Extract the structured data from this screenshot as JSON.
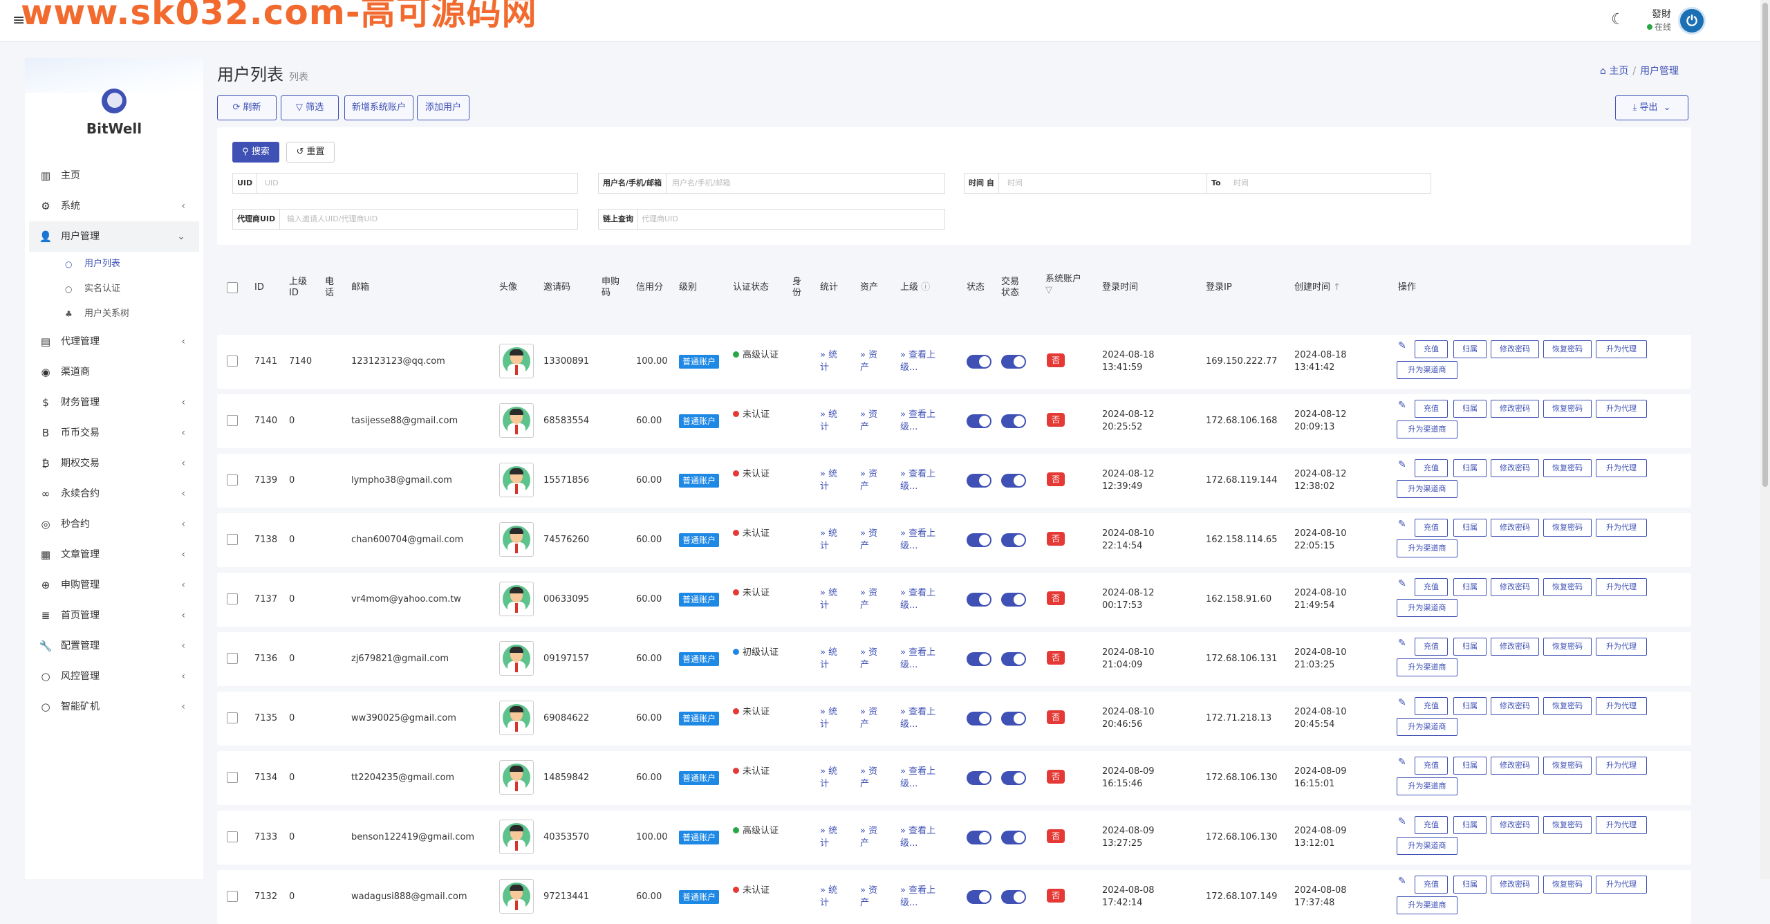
{
  "watermark": "www.sk032.com-高可源码网",
  "topbar": {
    "user_name": "發財",
    "user_status": "在线"
  },
  "sidebar": {
    "brand": "BitWell",
    "items": [
      {
        "label": "主页",
        "icon": "chart-bar-icon",
        "glyph": "▥",
        "chev": ""
      },
      {
        "label": "系统",
        "icon": "gear-icon",
        "glyph": "⚙",
        "chev": "‹"
      },
      {
        "label": "用户管理",
        "icon": "user-icon",
        "glyph": "👤",
        "chev": "⌄"
      },
      {
        "label": "代理管理",
        "icon": "id-card-icon",
        "glyph": "▤",
        "chev": "‹"
      },
      {
        "label": "渠道商",
        "icon": "user-circle-icon",
        "glyph": "◉",
        "chev": ""
      },
      {
        "label": "财务管理",
        "icon": "dollar-icon",
        "glyph": "$",
        "chev": "‹"
      },
      {
        "label": "币币交易",
        "icon": "bitcoin-icon",
        "glyph": "B",
        "chev": "‹"
      },
      {
        "label": "期权交易",
        "icon": "bitcoin-coin-icon",
        "glyph": "₿",
        "chev": "‹"
      },
      {
        "label": "永续合约",
        "icon": "link-icon",
        "glyph": "∞",
        "chev": "‹"
      },
      {
        "label": "秒合约",
        "icon": "dot-circle-icon",
        "glyph": "◎",
        "chev": "‹"
      },
      {
        "label": "文章管理",
        "icon": "newspaper-icon",
        "glyph": "▦",
        "chev": "‹"
      },
      {
        "label": "申购管理",
        "icon": "life-ring-icon",
        "glyph": "⊕",
        "chev": "‹"
      },
      {
        "label": "首页管理",
        "icon": "list-icon",
        "glyph": "≣",
        "chev": "‹"
      },
      {
        "label": "配置管理",
        "icon": "wrench-icon",
        "glyph": "🔧",
        "chev": "‹"
      },
      {
        "label": "风控管理",
        "icon": "circle-icon",
        "glyph": "○",
        "chev": "‹"
      },
      {
        "label": "智能矿机",
        "icon": "circle-icon",
        "glyph": "○",
        "chev": "‹"
      }
    ],
    "subitems": [
      {
        "label": "用户列表",
        "glyph": "○"
      },
      {
        "label": "实名认证",
        "glyph": "○"
      },
      {
        "label": "用户关系树",
        "glyph": "♣"
      }
    ]
  },
  "page": {
    "title": "用户列表",
    "subtitle": "列表"
  },
  "breadcrumb": {
    "home": "主页",
    "current": "用户管理"
  },
  "toolbar": {
    "refresh": "刷新",
    "filter": "筛选",
    "add_system": "新增系统账户",
    "add_user": "添加用户",
    "export": "导出"
  },
  "search": {
    "search_btn": "搜索",
    "reset_btn": "重置",
    "uid_label": "UID",
    "uid_ph": "UID",
    "name_label": "用户名/手机/邮箱",
    "name_ph": "用户名/手机/邮箱",
    "time_label": "时间 自",
    "time_from_ph": "时间",
    "to_label": "To",
    "time_to_ph": "时间",
    "agent_label": "代理商UID",
    "agent_ph": "输入邀请人UID/代理商UID",
    "chain_label": "链上查询",
    "chain_ph": "代理商UID"
  },
  "columns": {
    "id": "ID",
    "parent_id": "上级ID",
    "phone": "电话",
    "email": "邮箱",
    "avatar": "头像",
    "invite": "邀请码",
    "subscribe": "申购码",
    "credit": "信用分",
    "level": "级别",
    "auth": "认证状态",
    "identity": "身份",
    "stats": "统计",
    "assets": "资产",
    "superior": "上级",
    "status": "状态",
    "trade_status": "交易状态",
    "system_account": "系统账户",
    "login_time": "登录时间",
    "login_ip": "登录IP",
    "create_time": "创建时间",
    "actions": "操作"
  },
  "labels": {
    "stats_link": "» 统计",
    "assets_link": "» 资产",
    "superior_link": "» 查看上级...",
    "no": "否",
    "level_badge": "普通账户",
    "btn_recharge": "充值",
    "btn_belong": "归属",
    "btn_change_pwd": "修改密码",
    "btn_reset_pwd": "恢复密码",
    "btn_promote_agent": "升为代理",
    "btn_promote_channel": "升为渠道商"
  },
  "colors": {
    "accent": "#3f51b5",
    "status_green": "#28a745",
    "status_red": "#e53935",
    "status_blue": "#1e88e5",
    "badge": "#1e88e5"
  },
  "rows": [
    {
      "id": "7141",
      "parent": "7140",
      "email": "123123123@qq.com",
      "invite": "13300891",
      "credit": "100.00",
      "auth": "高级认证",
      "auth_color": "#28a745",
      "login_date": "2024-08-18",
      "login_clock": "13:41:59",
      "ip": "169.150.222.77",
      "create_date": "2024-08-18",
      "create_clock": "13:41:42"
    },
    {
      "id": "7140",
      "parent": "0",
      "email": "tasijesse88@gmail.com",
      "invite": "68583554",
      "credit": "60.00",
      "auth": "未认证",
      "auth_color": "#e53935",
      "login_date": "2024-08-12",
      "login_clock": "20:25:52",
      "ip": "172.68.106.168",
      "create_date": "2024-08-12",
      "create_clock": "20:09:13"
    },
    {
      "id": "7139",
      "parent": "0",
      "email": "lympho38@gmail.com",
      "invite": "15571856",
      "credit": "60.00",
      "auth": "未认证",
      "auth_color": "#e53935",
      "login_date": "2024-08-12",
      "login_clock": "12:39:49",
      "ip": "172.68.119.144",
      "create_date": "2024-08-12",
      "create_clock": "12:38:02"
    },
    {
      "id": "7138",
      "parent": "0",
      "email": "chan600704@gmail.com",
      "invite": "74576260",
      "credit": "60.00",
      "auth": "未认证",
      "auth_color": "#e53935",
      "login_date": "2024-08-10",
      "login_clock": "22:14:54",
      "ip": "162.158.114.65",
      "create_date": "2024-08-10",
      "create_clock": "22:05:15"
    },
    {
      "id": "7137",
      "parent": "0",
      "email": "vr4mom@yahoo.com.tw",
      "invite": "00633095",
      "credit": "60.00",
      "auth": "未认证",
      "auth_color": "#e53935",
      "login_date": "2024-08-12",
      "login_clock": "00:17:53",
      "ip": "162.158.91.60",
      "create_date": "2024-08-10",
      "create_clock": "21:49:54"
    },
    {
      "id": "7136",
      "parent": "0",
      "email": "zj679821@gmail.com",
      "invite": "09197157",
      "credit": "60.00",
      "auth": "初级认证",
      "auth_color": "#1e88e5",
      "login_date": "2024-08-10",
      "login_clock": "21:04:09",
      "ip": "172.68.106.131",
      "create_date": "2024-08-10",
      "create_clock": "21:03:25"
    },
    {
      "id": "7135",
      "parent": "0",
      "email": "ww390025@gmail.com",
      "invite": "69084622",
      "credit": "60.00",
      "auth": "未认证",
      "auth_color": "#e53935",
      "login_date": "2024-08-10",
      "login_clock": "20:46:56",
      "ip": "172.71.218.13",
      "create_date": "2024-08-10",
      "create_clock": "20:45:54"
    },
    {
      "id": "7134",
      "parent": "0",
      "email": "tt2204235@gmail.com",
      "invite": "14859842",
      "credit": "60.00",
      "auth": "未认证",
      "auth_color": "#e53935",
      "login_date": "2024-08-09",
      "login_clock": "16:15:46",
      "ip": "172.68.106.130",
      "create_date": "2024-08-09",
      "create_clock": "16:15:01"
    },
    {
      "id": "7133",
      "parent": "0",
      "email": "benson122419@gmail.com",
      "invite": "40353570",
      "credit": "100.00",
      "auth": "高级认证",
      "auth_color": "#28a745",
      "login_date": "2024-08-09",
      "login_clock": "13:27:25",
      "ip": "172.68.106.130",
      "create_date": "2024-08-09",
      "create_clock": "13:12:01"
    },
    {
      "id": "7132",
      "parent": "0",
      "email": "wadagusi888@gmail.com",
      "invite": "97213441",
      "credit": "60.00",
      "auth": "未认证",
      "auth_color": "#e53935",
      "login_date": "2024-08-08",
      "login_clock": "17:42:14",
      "ip": "172.68.107.149",
      "create_date": "2024-08-08",
      "create_clock": "17:37:48"
    }
  ]
}
